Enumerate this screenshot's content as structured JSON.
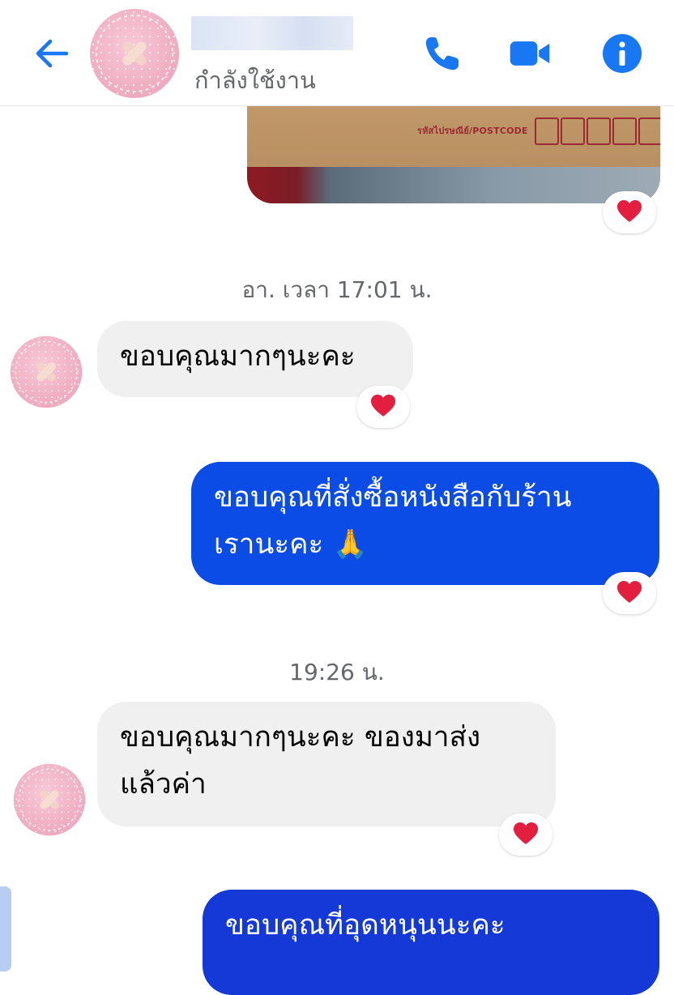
{
  "header": {
    "status": "กำลังใช้งาน",
    "icons": [
      "back-arrow-icon",
      "phone-icon",
      "video-camera-icon",
      "info-icon"
    ],
    "accent": "#1877f2"
  },
  "photo_message": {
    "postcode_label": "รหัสไปรษณีย์/POSTCODE"
  },
  "timestamps": [
    "อา. เวลา 17:01 น.",
    "19:26 น."
  ],
  "messages": [
    {
      "side": "incoming",
      "text": "ขอบคุณมากๆนะคะ",
      "reaction": "heart"
    },
    {
      "side": "outgoing",
      "line1": "ขอบคุณที่สั่งซื้อหนังสือกับร้าน",
      "line2": "เรานะคะ 🙏",
      "reaction": "heart"
    },
    {
      "side": "incoming",
      "line1": "ขอบคุณมากๆนะคะ ของมาส่ง",
      "line2": "แล้วค่า",
      "reaction": "heart"
    },
    {
      "side": "outgoing",
      "text": "ขอบคุณที่อุดหนุนนะคะ"
    }
  ],
  "colors": {
    "outgoing_bubble": "#0b4ce6",
    "incoming_bubble": "#f0f0f0",
    "heart": "#e41e3f"
  }
}
